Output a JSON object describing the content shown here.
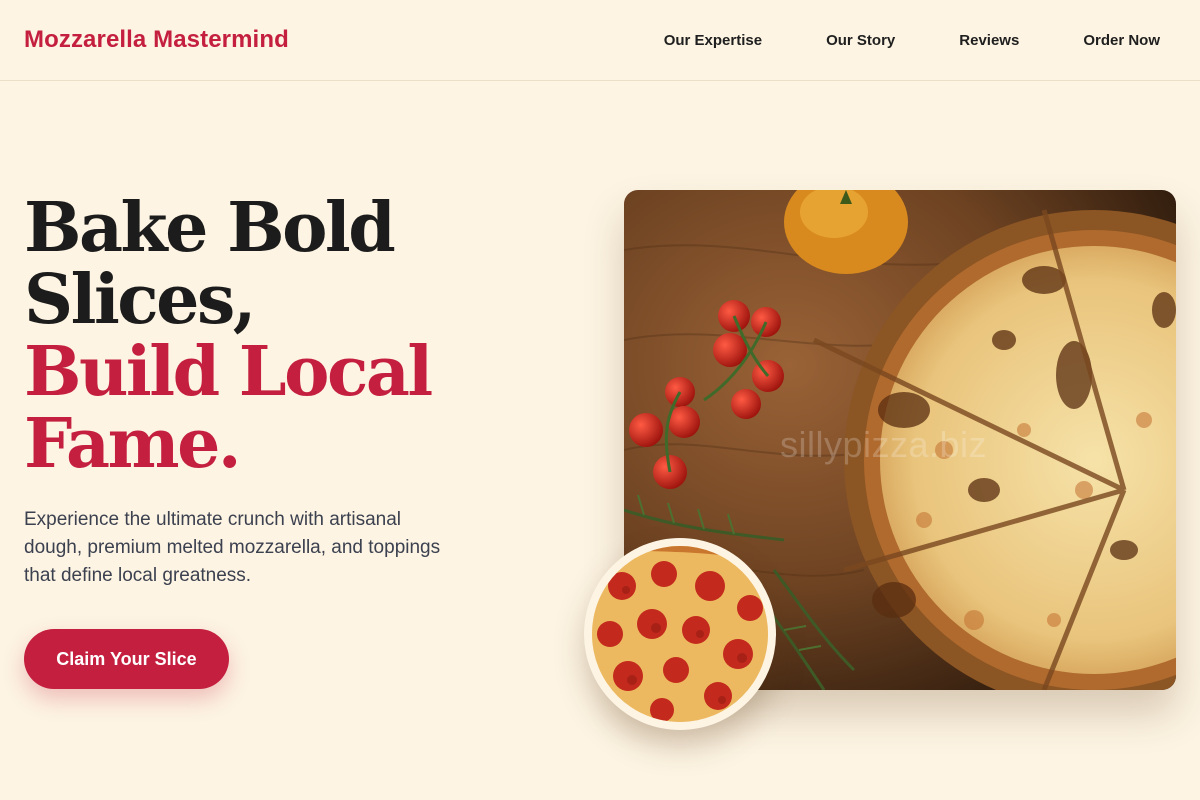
{
  "header": {
    "brand": "Mozzarella Mastermind",
    "nav": [
      {
        "label": "Our Expertise"
      },
      {
        "label": "Our Story"
      },
      {
        "label": "Reviews"
      },
      {
        "label": "Order Now"
      }
    ]
  },
  "hero": {
    "headline_lines": [
      "Bake Bold",
      "Slices,"
    ],
    "headline_accent_lines": [
      "Build Local",
      "Fame."
    ],
    "description": "Experience the ultimate crunch with artisanal dough, premium melted mozzarella, and toppings that define local greatness.",
    "cta_label": "Claim Your Slice",
    "watermark": "sillypizza.biz"
  },
  "colors": {
    "accent": "#c41f3e",
    "background": "#fdf4e3",
    "text_dark": "#1c1c1c",
    "text_body": "#3c4150"
  },
  "images": {
    "main_photo": "cheese-pizza-on-wooden-board-photo",
    "inset_photo": "pepperoni-pizza-photo"
  }
}
